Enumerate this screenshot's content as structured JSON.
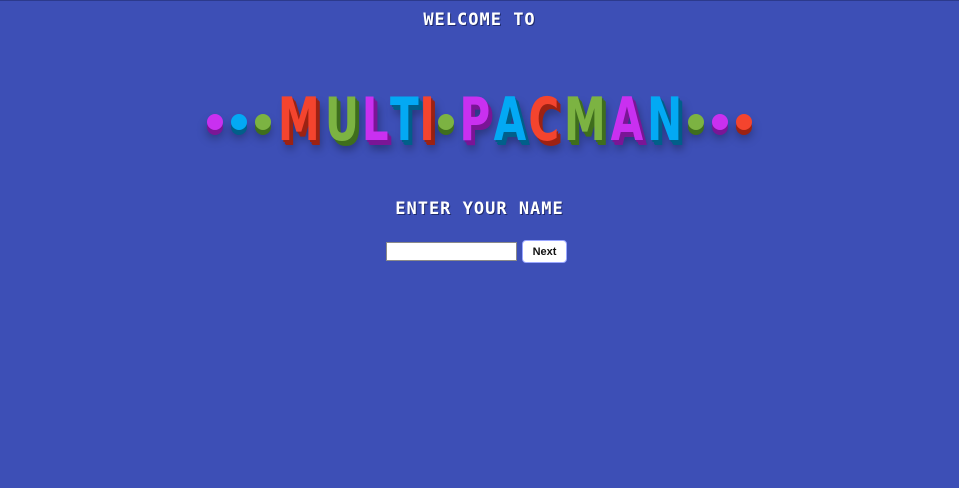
{
  "header": {
    "welcome_text": "WELCOME TO"
  },
  "logo": {
    "text": "MULTI•PACMAN",
    "words": [
      {
        "letters": [
          {
            "char": "M",
            "color": "#f4442e",
            "shade": "#9c2213"
          },
          {
            "char": "U",
            "color": "#7cb342",
            "shade": "#3f6e1d"
          },
          {
            "char": "L",
            "color": "#c930f0",
            "shade": "#7a1596"
          },
          {
            "char": "T",
            "color": "#03a9f4",
            "shade": "#015f8a"
          },
          {
            "char": "I",
            "color": "#f4442e",
            "shade": "#9c2213"
          }
        ]
      },
      {
        "letters": [
          {
            "char": "P",
            "color": "#c930f0",
            "shade": "#7a1596"
          },
          {
            "char": "A",
            "color": "#03a9f4",
            "shade": "#015f8a"
          },
          {
            "char": "C",
            "color": "#f4442e",
            "shade": "#9c2213"
          },
          {
            "char": "M",
            "color": "#7cb342",
            "shade": "#3f6e1d"
          },
          {
            "char": "A",
            "color": "#c930f0",
            "shade": "#7a1596"
          },
          {
            "char": "N",
            "color": "#03a9f4",
            "shade": "#015f8a"
          }
        ]
      }
    ],
    "left_dots": [
      "#c930f0",
      "#03a9f4",
      "#7cb342"
    ],
    "middle_dot": "#7cb342",
    "right_dots": [
      "#7cb342",
      "#c930f0",
      "#f4442e"
    ]
  },
  "form": {
    "title": "ENTER YOUR NAME",
    "name_value": "",
    "name_placeholder": "",
    "next_label": "Next"
  },
  "colors": {
    "background": "#3d4fb6"
  }
}
